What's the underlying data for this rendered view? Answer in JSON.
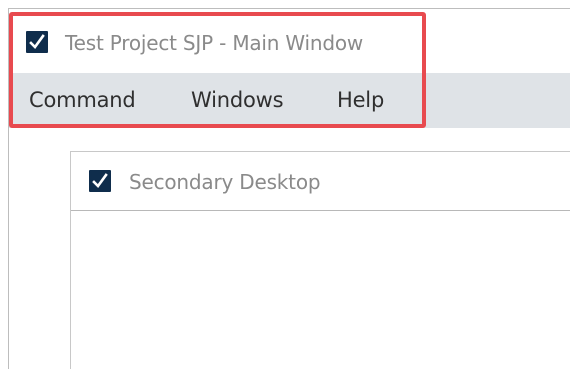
{
  "main_window": {
    "title": "Test Project SJP - Main Window",
    "icon": "checkmark-app-icon"
  },
  "menu": {
    "items": [
      {
        "label": "Command"
      },
      {
        "label": "Windows"
      },
      {
        "label": "Help"
      }
    ]
  },
  "secondary_window": {
    "title": "Secondary Desktop",
    "icon": "checkmark-app-icon"
  },
  "colors": {
    "icon_background": "#0f2d4c",
    "menu_bar": "#dfe3e7",
    "highlight": "#e84a4f",
    "title_text": "#8a8a8a",
    "menu_text": "#2f2f2f"
  }
}
